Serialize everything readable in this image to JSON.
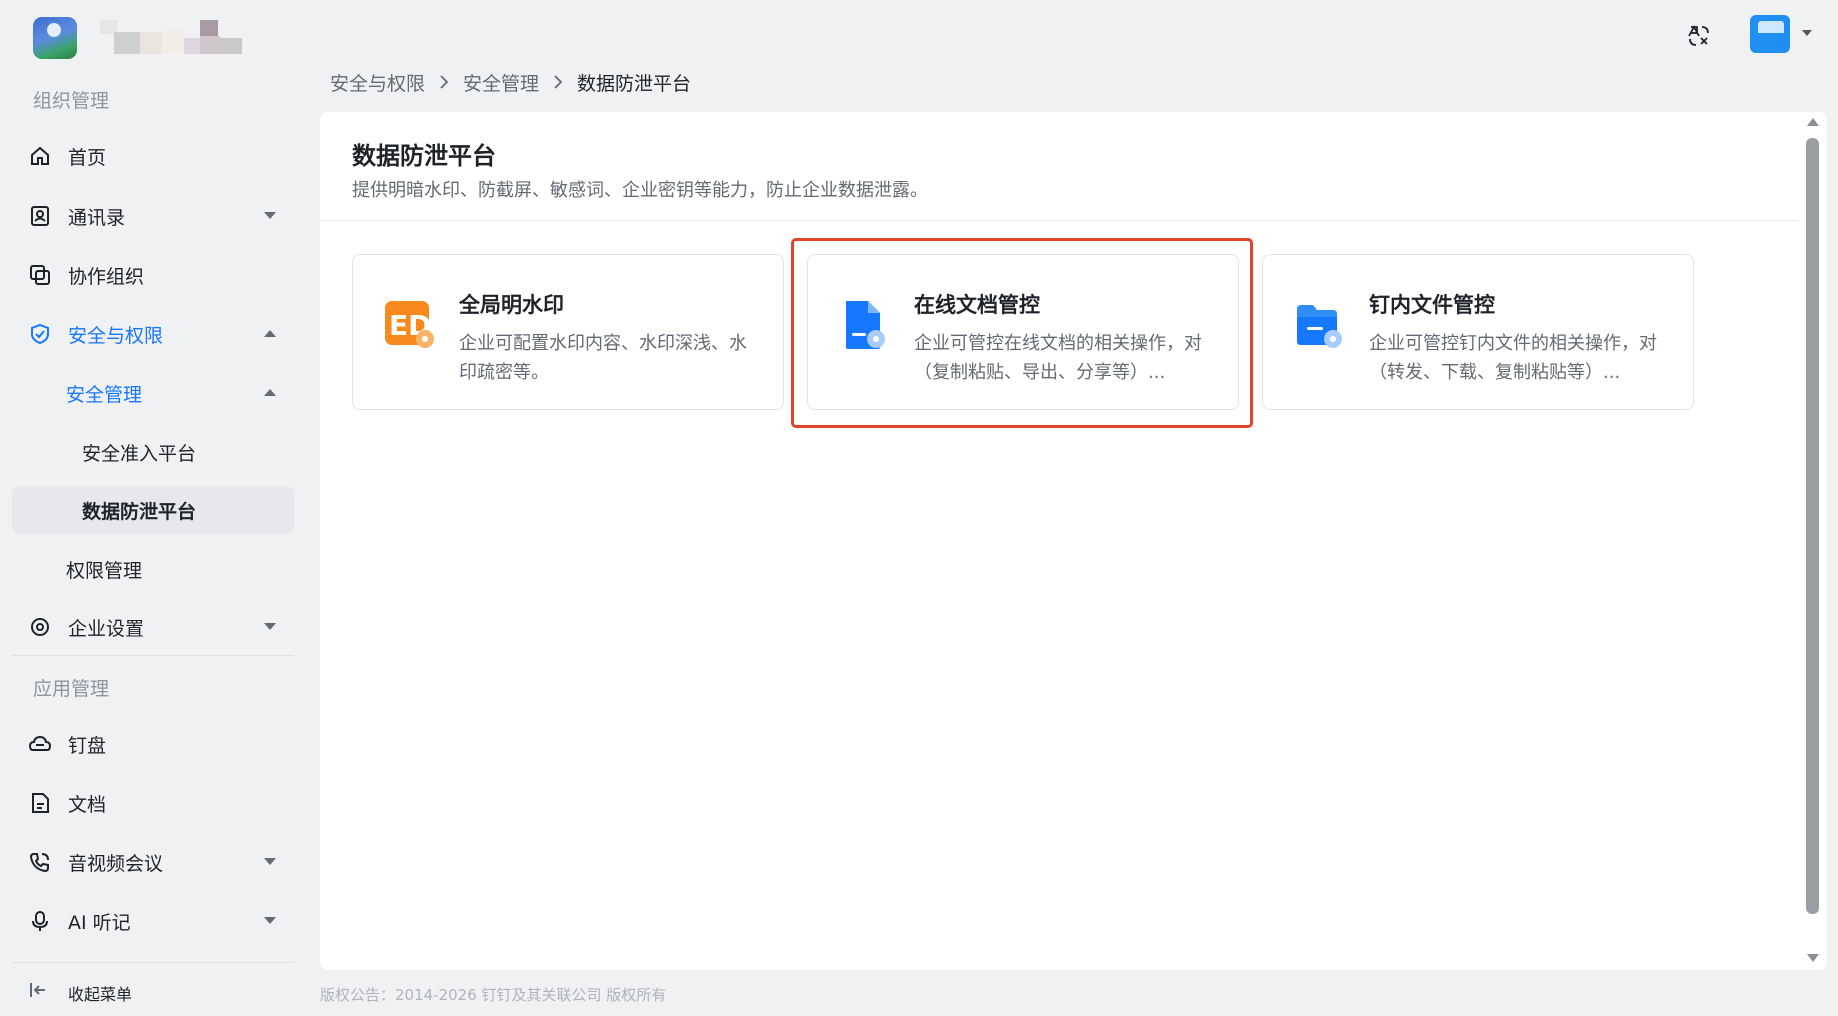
{
  "header": {
    "translate_icon": "translate-icon",
    "avatar_icon": "user-avatar"
  },
  "sidebar": {
    "section_org": "组织管理",
    "home": "首页",
    "contacts": "通讯录",
    "collab": "协作组织",
    "security_perm": "安全与权限",
    "security_mgmt": "安全管理",
    "secure_access": "安全准入平台",
    "dlp": "数据防泄平台",
    "permission_mgmt": "权限管理",
    "enterprise_settings": "企业设置",
    "section_apps": "应用管理",
    "drive": "钉盘",
    "docs": "文档",
    "meeting": "音视频会议",
    "ai_notes": "AI 听记",
    "collapse": "收起菜单"
  },
  "breadcrumb": {
    "items": [
      "安全与权限",
      "安全管理",
      "数据防泄平台"
    ]
  },
  "main": {
    "title": "数据防泄平台",
    "description": "提供明暗水印、防截屏、敏感词、企业密钥等能力，防止企业数据泄露。",
    "cards": [
      {
        "icon": "watermark-icon",
        "title": "全局明水印",
        "desc": "企业可配置水印内容、水印深浅、水印疏密等。"
      },
      {
        "icon": "online-doc-icon",
        "title": "在线文档管控",
        "desc": "企业可管控在线文档的相关操作，对（复制粘贴、导出、分享等）..."
      },
      {
        "icon": "folder-icon",
        "title": "钉内文件管控",
        "desc": "企业可管控钉内文件的相关操作，对（转发、下载、复制粘贴等）..."
      }
    ]
  },
  "footer": {
    "copyright": "版权公告：2014-2026 钉钉及其关联公司 版权所有"
  },
  "colors": {
    "accent": "#1677ff",
    "highlight": "#e0442a",
    "watermark_orange": "#f7891d"
  }
}
